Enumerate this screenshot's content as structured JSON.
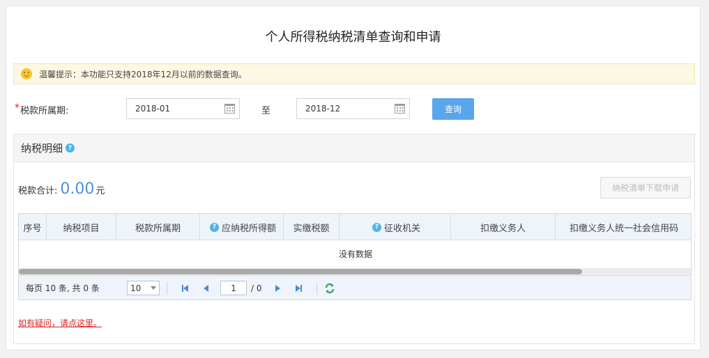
{
  "page": {
    "title": "个人所得税纳税清单查询和申请"
  },
  "notice": {
    "text": "温馨提示：本功能只支持2018年12月以前的数据查询。"
  },
  "filter": {
    "required_mark": "*",
    "period_label": "税款所属期:",
    "start_date": "2018-01",
    "to_label": "至",
    "end_date": "2018-12",
    "query_label": "查询"
  },
  "panel": {
    "title": "纳税明细",
    "total_label": "税款合计:",
    "total_value": "0.00",
    "total_unit": "元",
    "download_label": "纳税清单下载申请"
  },
  "table": {
    "columns": [
      {
        "label": "序号",
        "help": false
      },
      {
        "label": "纳税项目",
        "help": false
      },
      {
        "label": "税款所属期",
        "help": false
      },
      {
        "label": "应纳税所得额",
        "help": true
      },
      {
        "label": "实缴税额",
        "help": false
      },
      {
        "label": "征收机关",
        "help": true
      },
      {
        "label": "扣缴义务人",
        "help": false
      },
      {
        "label": "扣缴义务人统一社会信用码",
        "help": false
      }
    ],
    "empty_text": "没有数据"
  },
  "pager": {
    "info": "每页 10 条, 共 0 条",
    "page_size": "10",
    "current_page": "1",
    "total_pages": "/ 0"
  },
  "help_link": "如有疑问，请点这里。",
  "colors": {
    "accent": "#5aa6ec",
    "warning_bg": "#fcf8e3",
    "required": "#e02020",
    "link": "#e02020"
  },
  "icons": {
    "notice": "smile-icon",
    "calendar": "calendar-icon",
    "help": "help-icon",
    "refresh": "refresh-icon"
  }
}
